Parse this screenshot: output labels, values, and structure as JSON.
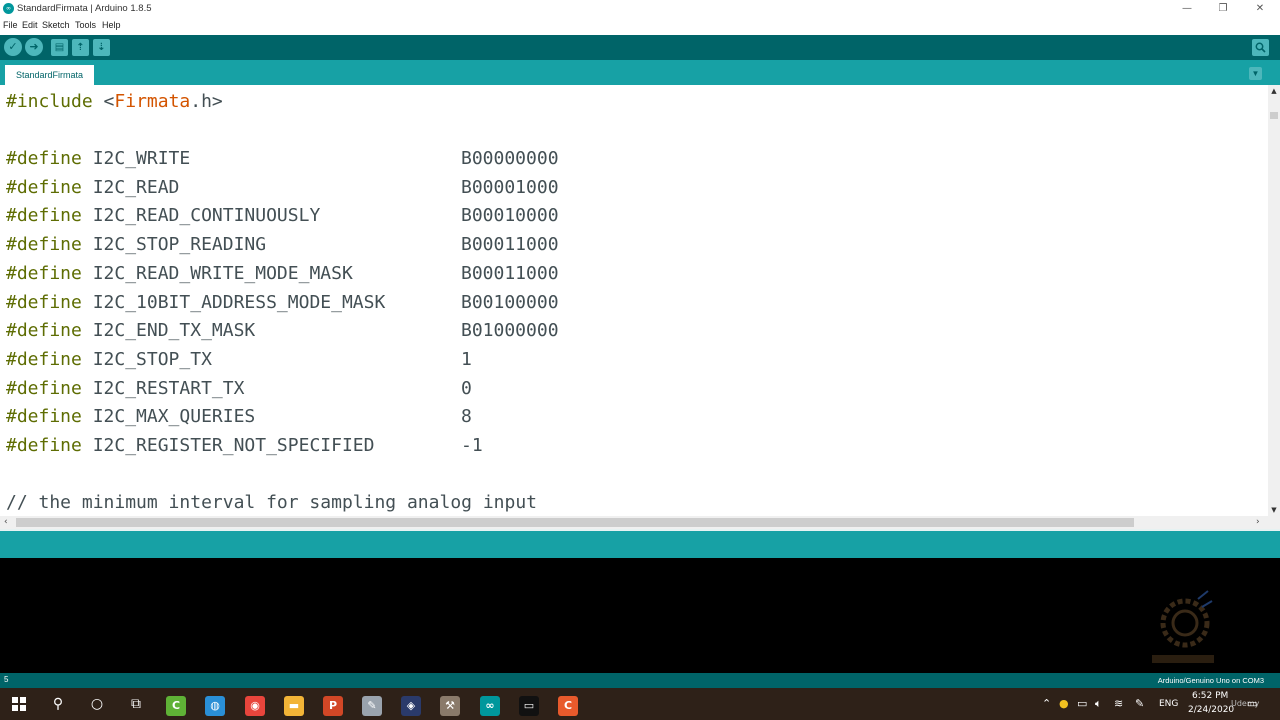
{
  "window": {
    "title": "StandardFirmata | Arduino 1.8.5",
    "app_icon": "arduino-logo-icon",
    "controls": [
      "minimize-icon",
      "restore-icon",
      "close-icon"
    ]
  },
  "menu": {
    "items": [
      "File",
      "Edit",
      "Sketch",
      "Tools",
      "Help"
    ]
  },
  "toolbar": {
    "buttons": [
      {
        "name": "verify-button",
        "icon": "check-icon",
        "glyph": "✓"
      },
      {
        "name": "upload-button",
        "icon": "arrow-right-icon",
        "glyph": "➜"
      },
      {
        "name": "new-button",
        "icon": "new-file-icon",
        "glyph": "▤"
      },
      {
        "name": "open-button",
        "icon": "arrow-up-icon",
        "glyph": "⇡"
      },
      {
        "name": "save-button",
        "icon": "arrow-down-icon",
        "glyph": "⇣"
      }
    ],
    "serial_monitor_icon": "magnifier-icon"
  },
  "tabs": {
    "items": [
      {
        "label": "StandardFirmata",
        "active": true
      }
    ],
    "menu_icon": "chevron-down-icon"
  },
  "editor": {
    "include_keyword": "#include",
    "include_open": " <",
    "include_lib": "Firmata",
    "include_close": ".h>",
    "define_keyword": "#define",
    "defines": [
      {
        "name": "I2C_WRITE",
        "value": "B00000000"
      },
      {
        "name": "I2C_READ",
        "value": "B00001000"
      },
      {
        "name": "I2C_READ_CONTINUOUSLY",
        "value": "B00010000"
      },
      {
        "name": "I2C_STOP_READING",
        "value": "B00011000"
      },
      {
        "name": "I2C_READ_WRITE_MODE_MASK",
        "value": "B00011000"
      },
      {
        "name": "I2C_10BIT_ADDRESS_MODE_MASK",
        "value": "B00100000"
      },
      {
        "name": "I2C_END_TX_MASK",
        "value": "B01000000"
      },
      {
        "name": "I2C_STOP_TX",
        "value": "1"
      },
      {
        "name": "I2C_RESTART_TX",
        "value": "0"
      },
      {
        "name": "I2C_MAX_QUERIES",
        "value": "8"
      },
      {
        "name": "I2C_REGISTER_NOT_SPECIFIED",
        "value": "-1"
      }
    ],
    "comment": "// the minimum interval for sampling analog input"
  },
  "status": {
    "line_number": "5",
    "board": "Arduino/Genuino Uno on COM3"
  },
  "taskbar": {
    "start_icon": "windows-start-icon",
    "apps": [
      {
        "name": "search-icon",
        "glyph": "⚲"
      },
      {
        "name": "cortana-icon",
        "glyph": "○"
      },
      {
        "name": "task-view-icon",
        "glyph": "⧉"
      },
      {
        "name": "camtasia-icon",
        "glyph": "C",
        "color": "#5fb236"
      },
      {
        "name": "globe-app-icon",
        "glyph": "◍",
        "color": "#2a8fd6"
      },
      {
        "name": "chrome-icon",
        "glyph": "◉",
        "color": "#e8453c"
      },
      {
        "name": "file-explorer-icon",
        "glyph": "▬",
        "color": "#f2b437"
      },
      {
        "name": "powerpoint-icon",
        "glyph": "P",
        "color": "#d24726"
      },
      {
        "name": "paint-app-icon",
        "glyph": "✎",
        "color": "#9aa3ad"
      },
      {
        "name": "app-icon-dark",
        "glyph": "◈",
        "color": "#2a3a6a"
      },
      {
        "name": "tool-app-icon",
        "glyph": "⚒",
        "color": "#8a7a6a"
      },
      {
        "name": "arduino-taskbar-icon",
        "glyph": "∞",
        "color": "#00979c"
      },
      {
        "name": "terminal-icon",
        "glyph": "▭",
        "color": "#111111"
      },
      {
        "name": "camtasia-recorder-icon",
        "glyph": "C",
        "color": "#e85a2c"
      }
    ],
    "tray": {
      "language": "ENG",
      "time": "6:52 PM",
      "date": "2/24/2020",
      "watermark_text": "Udemy"
    }
  },
  "colors": {
    "toolbar": "#006468",
    "tabbar": "#17a1a5",
    "keyword": "#5e6d03",
    "library": "#d35400",
    "text": "#434f54"
  }
}
